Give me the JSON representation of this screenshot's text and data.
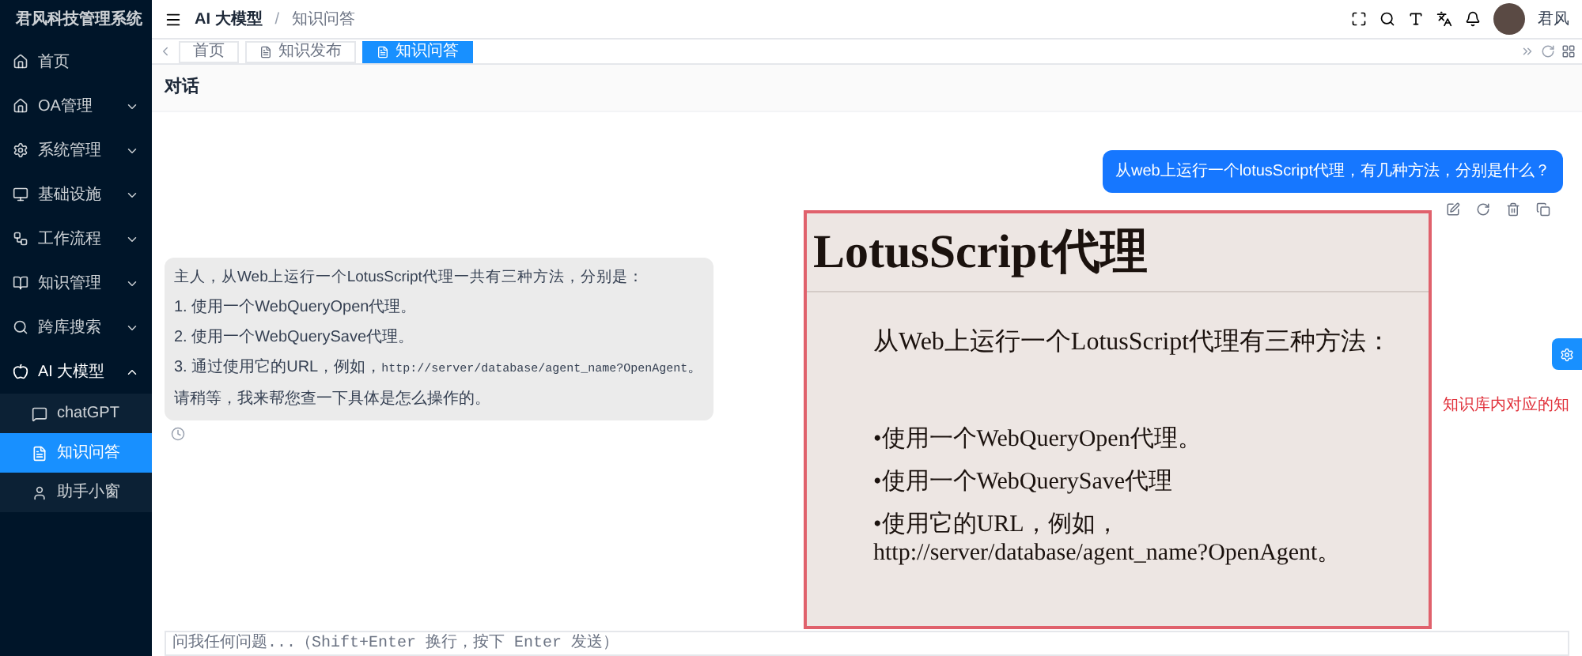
{
  "app": {
    "title": "君风科技管理系统"
  },
  "sidebar": {
    "items": [
      {
        "label": "首页"
      },
      {
        "label": "OA管理",
        "expanded": false
      },
      {
        "label": "系统管理",
        "expanded": false
      },
      {
        "label": "基础设施",
        "expanded": false
      },
      {
        "label": "工作流程",
        "expanded": false
      },
      {
        "label": "知识管理",
        "expanded": false
      },
      {
        "label": "跨库搜索",
        "expanded": false
      },
      {
        "label": "AI 大模型",
        "expanded": true,
        "children": [
          {
            "label": "chatGPT",
            "selected": false
          },
          {
            "label": "知识问答",
            "selected": true
          },
          {
            "label": "助手小窗",
            "selected": false
          }
        ]
      }
    ]
  },
  "header": {
    "breadcrumbs": [
      "AI 大模型",
      "知识问答"
    ],
    "separator": "/",
    "user": "君风"
  },
  "tabs": [
    {
      "label": "首页",
      "selected": false
    },
    {
      "label": "知识发布",
      "selected": false
    },
    {
      "label": "知识问答",
      "selected": true
    }
  ],
  "page": {
    "title": "对话"
  },
  "chat": {
    "user_message": "从web上运行一个lotusScript代理，有几种方法，分别是什么？",
    "assistant": {
      "intro": "主人，从Web上运行一个LotusScript代理一共有三种方法，分别是：",
      "items": [
        {
          "text": "1. 使用一个WebQueryOpen代理。"
        },
        {
          "text": "2. 使用一个WebQuerySave代理。"
        },
        {
          "text": "3. 通过使用它的URL，例如，",
          "code": "http://server/database/agent_name?OpenAgent",
          "after": "。"
        }
      ],
      "closing": "请稍等，我来帮您查一下具体是怎么操作的。"
    }
  },
  "overlay": {
    "title": "LotusScript代理",
    "intro": "从Web上运行一个LotusScript代理有三种方法：",
    "bullets": [
      "•使用一个WebQueryOpen代理。",
      "•使用一个WebQuerySave代理",
      "•使用它的URL，例如，\nhttp://server/database/agent_name?OpenAgent。"
    ],
    "annotation": "知识库内对应的知"
  },
  "input": {
    "placeholder": "问我任何问题...（Shift+Enter 换行，按下 Enter 发送）"
  }
}
